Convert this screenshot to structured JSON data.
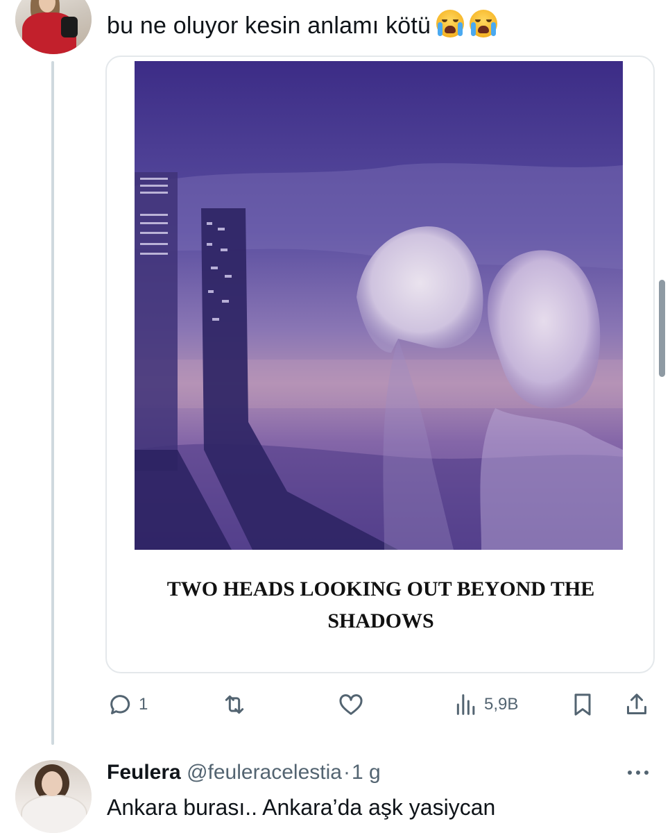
{
  "tweet": {
    "text": "bu ne oluyor kesin anlamı kötü",
    "emojis": [
      "loudly-crying-face-icon",
      "loudly-crying-face-icon"
    ],
    "card": {
      "caption": "TWO HEADS LOOKING OUT BEYOND THE SHADOWS"
    },
    "actions": {
      "reply_count": "1",
      "retweet_count": "",
      "like_count": "",
      "views_count": "5,9B"
    }
  },
  "reply": {
    "display_name": "Feulera",
    "handle": "@feuleracelestia",
    "separator": "·",
    "time": "1 g",
    "text": "Ankara burası.. Ankara’da aşk yasiycan"
  },
  "colors": {
    "text_primary": "#0f1419",
    "text_secondary": "#536471",
    "border": "#e4e8eb",
    "thread_line": "#cfd9de"
  }
}
